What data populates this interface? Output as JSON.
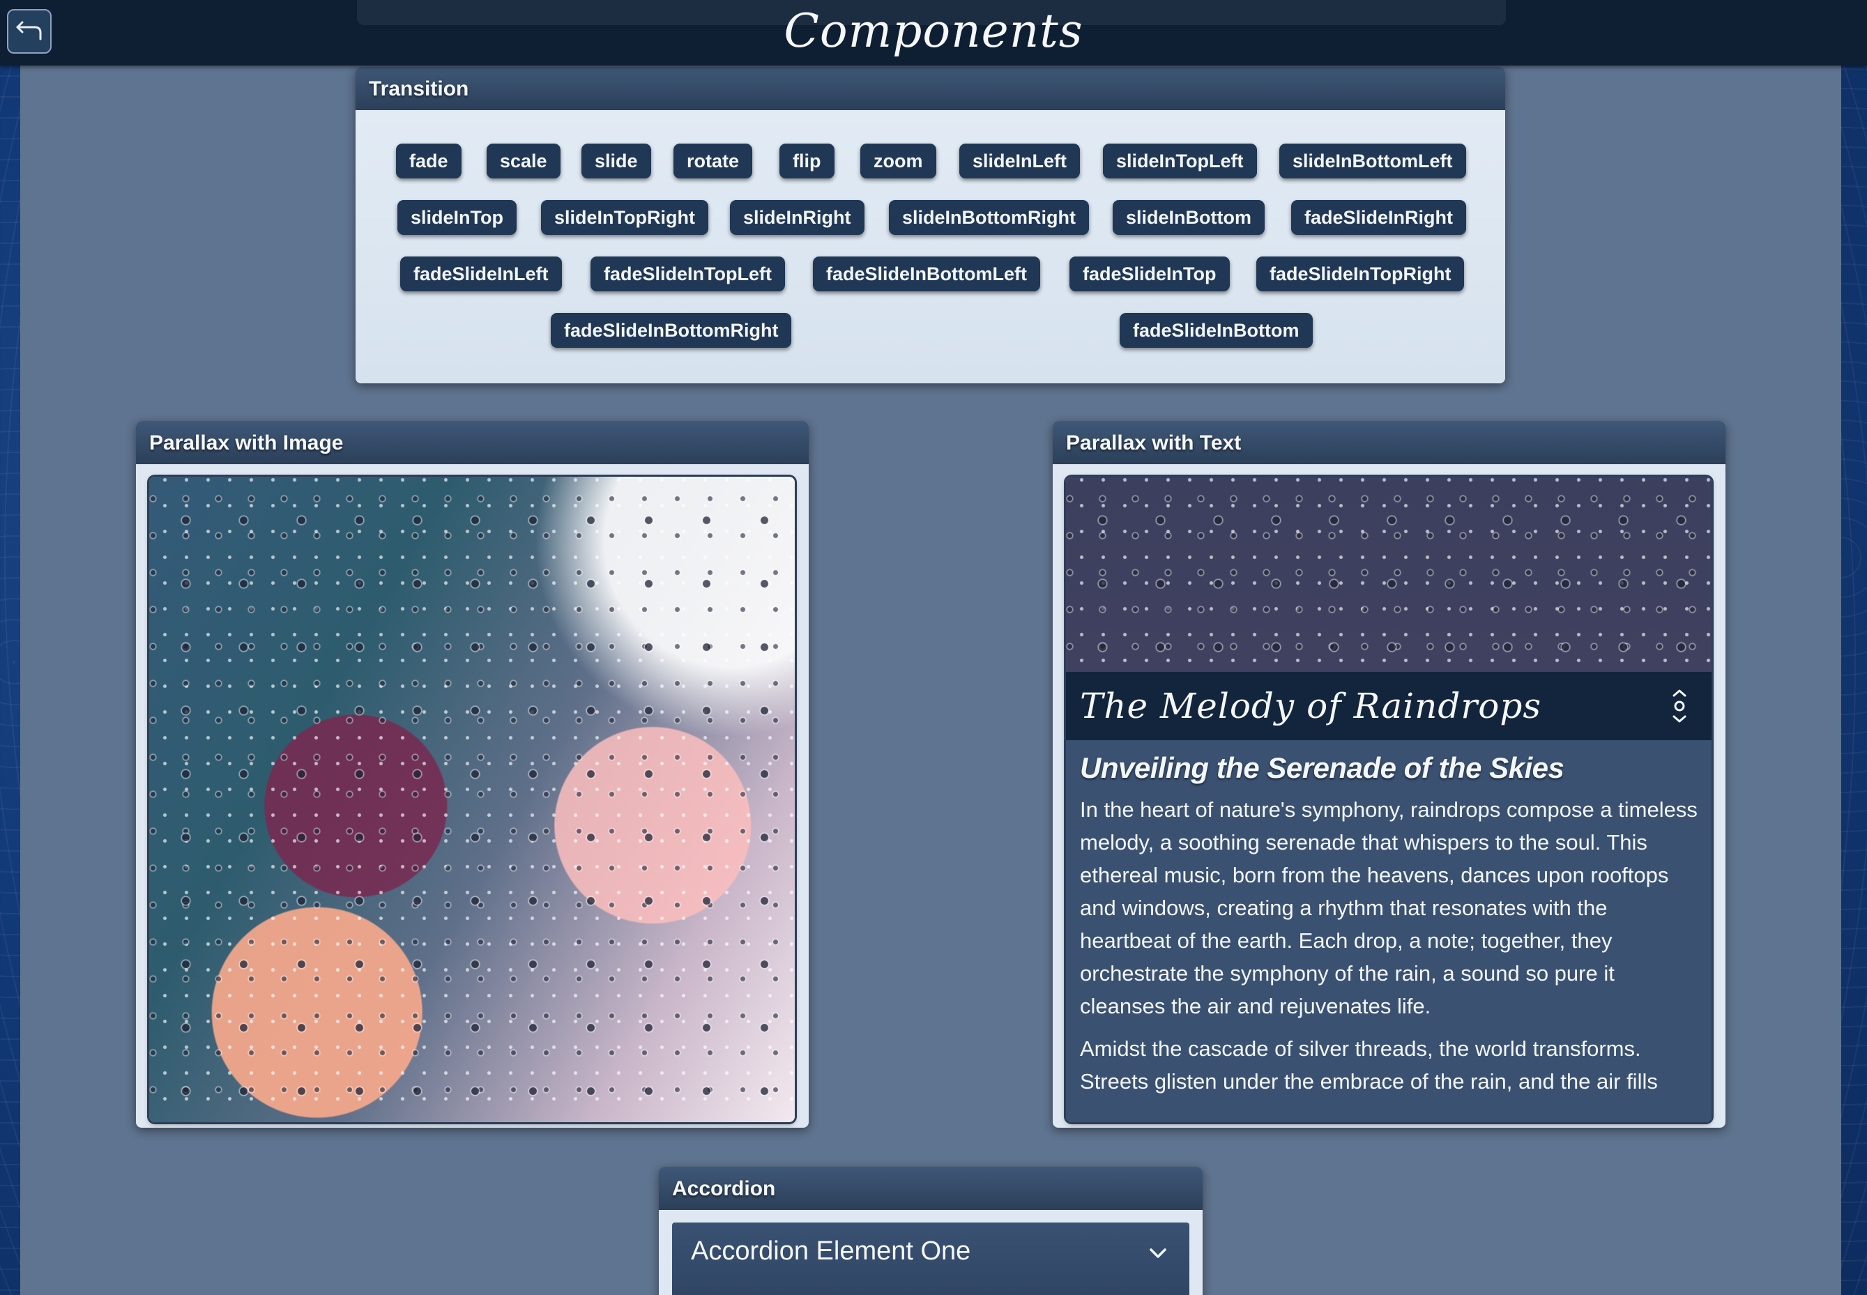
{
  "header": {
    "title": "Components",
    "back_icon": "back-arrow-icon"
  },
  "transition": {
    "title": "Transition",
    "buttons": [
      "fade",
      "scale",
      "slide",
      "rotate",
      "flip",
      "zoom",
      "slideInLeft",
      "slideInTopLeft",
      "slideInBottomLeft",
      "slideInTop",
      "slideInTopRight",
      "slideInRight",
      "slideInBottomRight",
      "slideInBottom",
      "fadeSlideInRight",
      "fadeSlideInLeft",
      "fadeSlideInTopLeft",
      "fadeSlideInBottomLeft",
      "fadeSlideInTop",
      "fadeSlideInTopRight",
      "fadeSlideInBottomRight",
      "fadeSlideInBottom"
    ]
  },
  "parallax_image": {
    "title": "Parallax with Image"
  },
  "parallax_text": {
    "title": "Parallax with Text",
    "heading": "The Melody of Raindrops",
    "subheading": "Unveiling the Serenade of the Skies",
    "paragraphs": [
      "In the heart of nature's symphony, raindrops compose a timeless melody, a soothing serenade that whispers to the soul. This ethereal music, born from the heavens, dances upon rooftops and windows, creating a rhythm that resonates with the heartbeat of the earth. Each drop, a note; together, they orchestrate the symphony of the rain, a sound so pure it cleanses the air and rejuvenates life.",
      "Amidst the cascade of silver threads, the world transforms. Streets glisten under the embrace of the rain, and the air fills"
    ]
  },
  "accordion": {
    "title": "Accordion",
    "items": [
      "Accordion Element One"
    ]
  },
  "colors": {
    "page_bg": "#5f7490",
    "topbar": "#0e1e33",
    "chip": "#203755",
    "card_header": "#2b3f59",
    "card_body": "#dfe8f2"
  }
}
